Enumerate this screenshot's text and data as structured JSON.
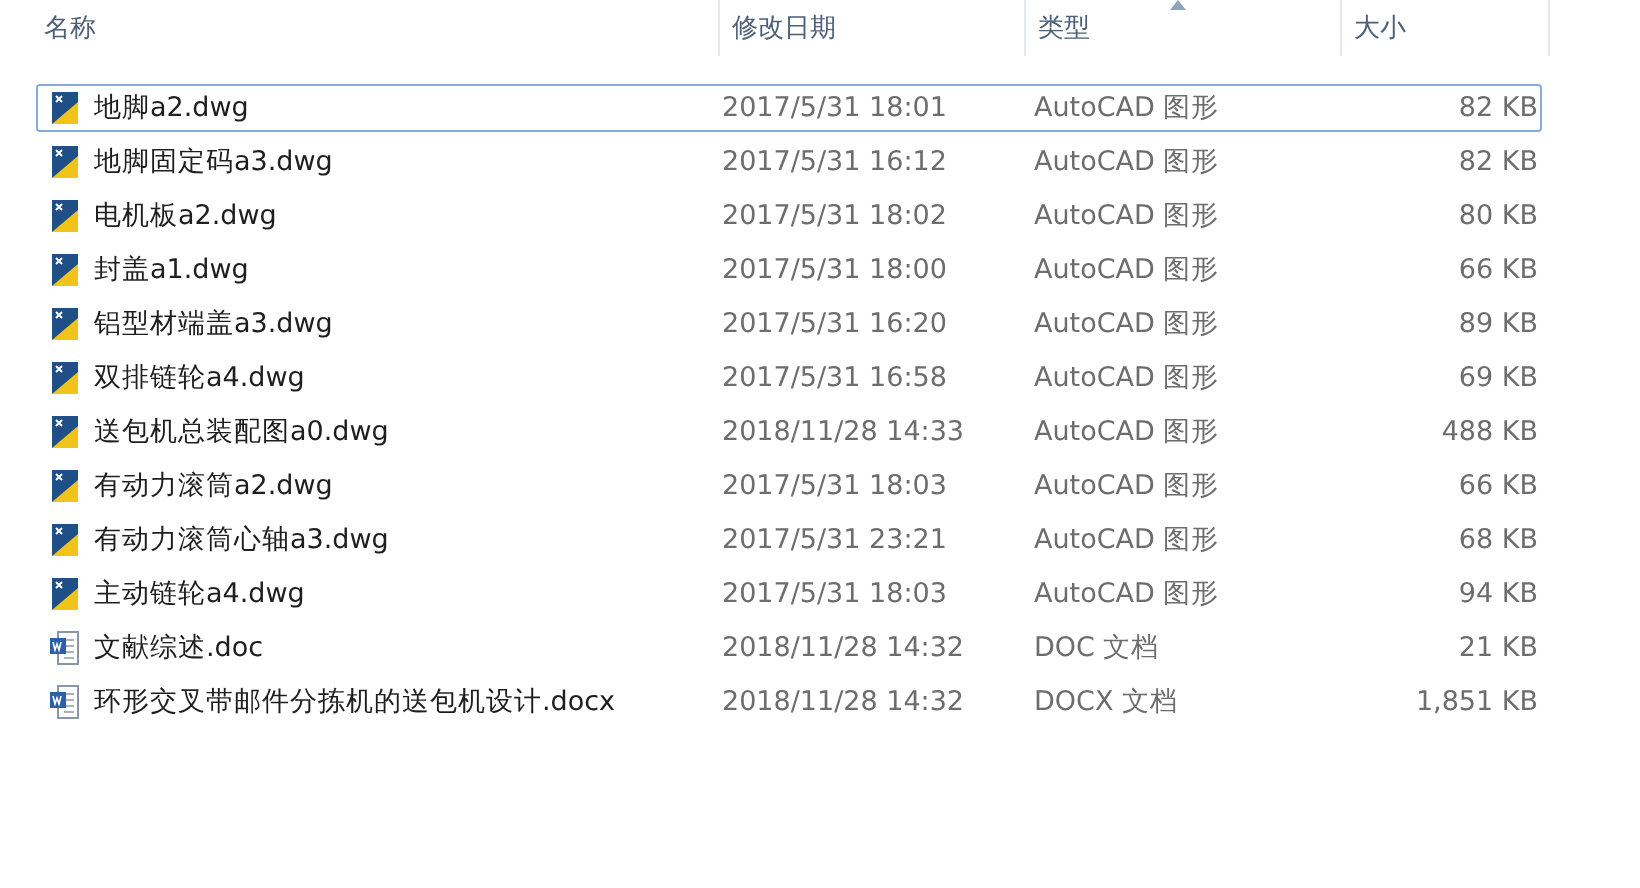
{
  "columns": [
    {
      "label": "名称",
      "sorted": false
    },
    {
      "label": "修改日期",
      "sorted": false
    },
    {
      "label": "类型",
      "sorted": true
    },
    {
      "label": "大小",
      "sorted": false
    }
  ],
  "rows": [
    {
      "kind": "dwg",
      "name": "地脚a2.dwg",
      "date": "2017/5/31 18:01",
      "type": "AutoCAD 图形",
      "size": "82 KB",
      "focused": true
    },
    {
      "kind": "dwg",
      "name": "地脚固定码a3.dwg",
      "date": "2017/5/31 16:12",
      "type": "AutoCAD 图形",
      "size": "82 KB",
      "focused": false
    },
    {
      "kind": "dwg",
      "name": "电机板a2.dwg",
      "date": "2017/5/31 18:02",
      "type": "AutoCAD 图形",
      "size": "80 KB",
      "focused": false
    },
    {
      "kind": "dwg",
      "name": "封盖a1.dwg",
      "date": "2017/5/31 18:00",
      "type": "AutoCAD 图形",
      "size": "66 KB",
      "focused": false
    },
    {
      "kind": "dwg",
      "name": "铝型材端盖a3.dwg",
      "date": "2017/5/31 16:20",
      "type": "AutoCAD 图形",
      "size": "89 KB",
      "focused": false
    },
    {
      "kind": "dwg",
      "name": "双排链轮a4.dwg",
      "date": "2017/5/31 16:58",
      "type": "AutoCAD 图形",
      "size": "69 KB",
      "focused": false
    },
    {
      "kind": "dwg",
      "name": "送包机总装配图a0.dwg",
      "date": "2018/11/28 14:33",
      "type": "AutoCAD 图形",
      "size": "488 KB",
      "focused": false
    },
    {
      "kind": "dwg",
      "name": "有动力滚筒a2.dwg",
      "date": "2017/5/31 18:03",
      "type": "AutoCAD 图形",
      "size": "66 KB",
      "focused": false
    },
    {
      "kind": "dwg",
      "name": "有动力滚筒心轴a3.dwg",
      "date": "2017/5/31 23:21",
      "type": "AutoCAD 图形",
      "size": "68 KB",
      "focused": false
    },
    {
      "kind": "dwg",
      "name": "主动链轮a4.dwg",
      "date": "2017/5/31 18:03",
      "type": "AutoCAD 图形",
      "size": "94 KB",
      "focused": false
    },
    {
      "kind": "doc",
      "name": "文献综述.doc",
      "date": "2018/11/28 14:32",
      "type": "DOC 文档",
      "size": "21 KB",
      "focused": false
    },
    {
      "kind": "doc",
      "name": "环形交叉带邮件分拣机的送包机设计.docx",
      "date": "2018/11/28 14:32",
      "type": "DOCX 文档",
      "size": "1,851 KB",
      "focused": false
    }
  ]
}
